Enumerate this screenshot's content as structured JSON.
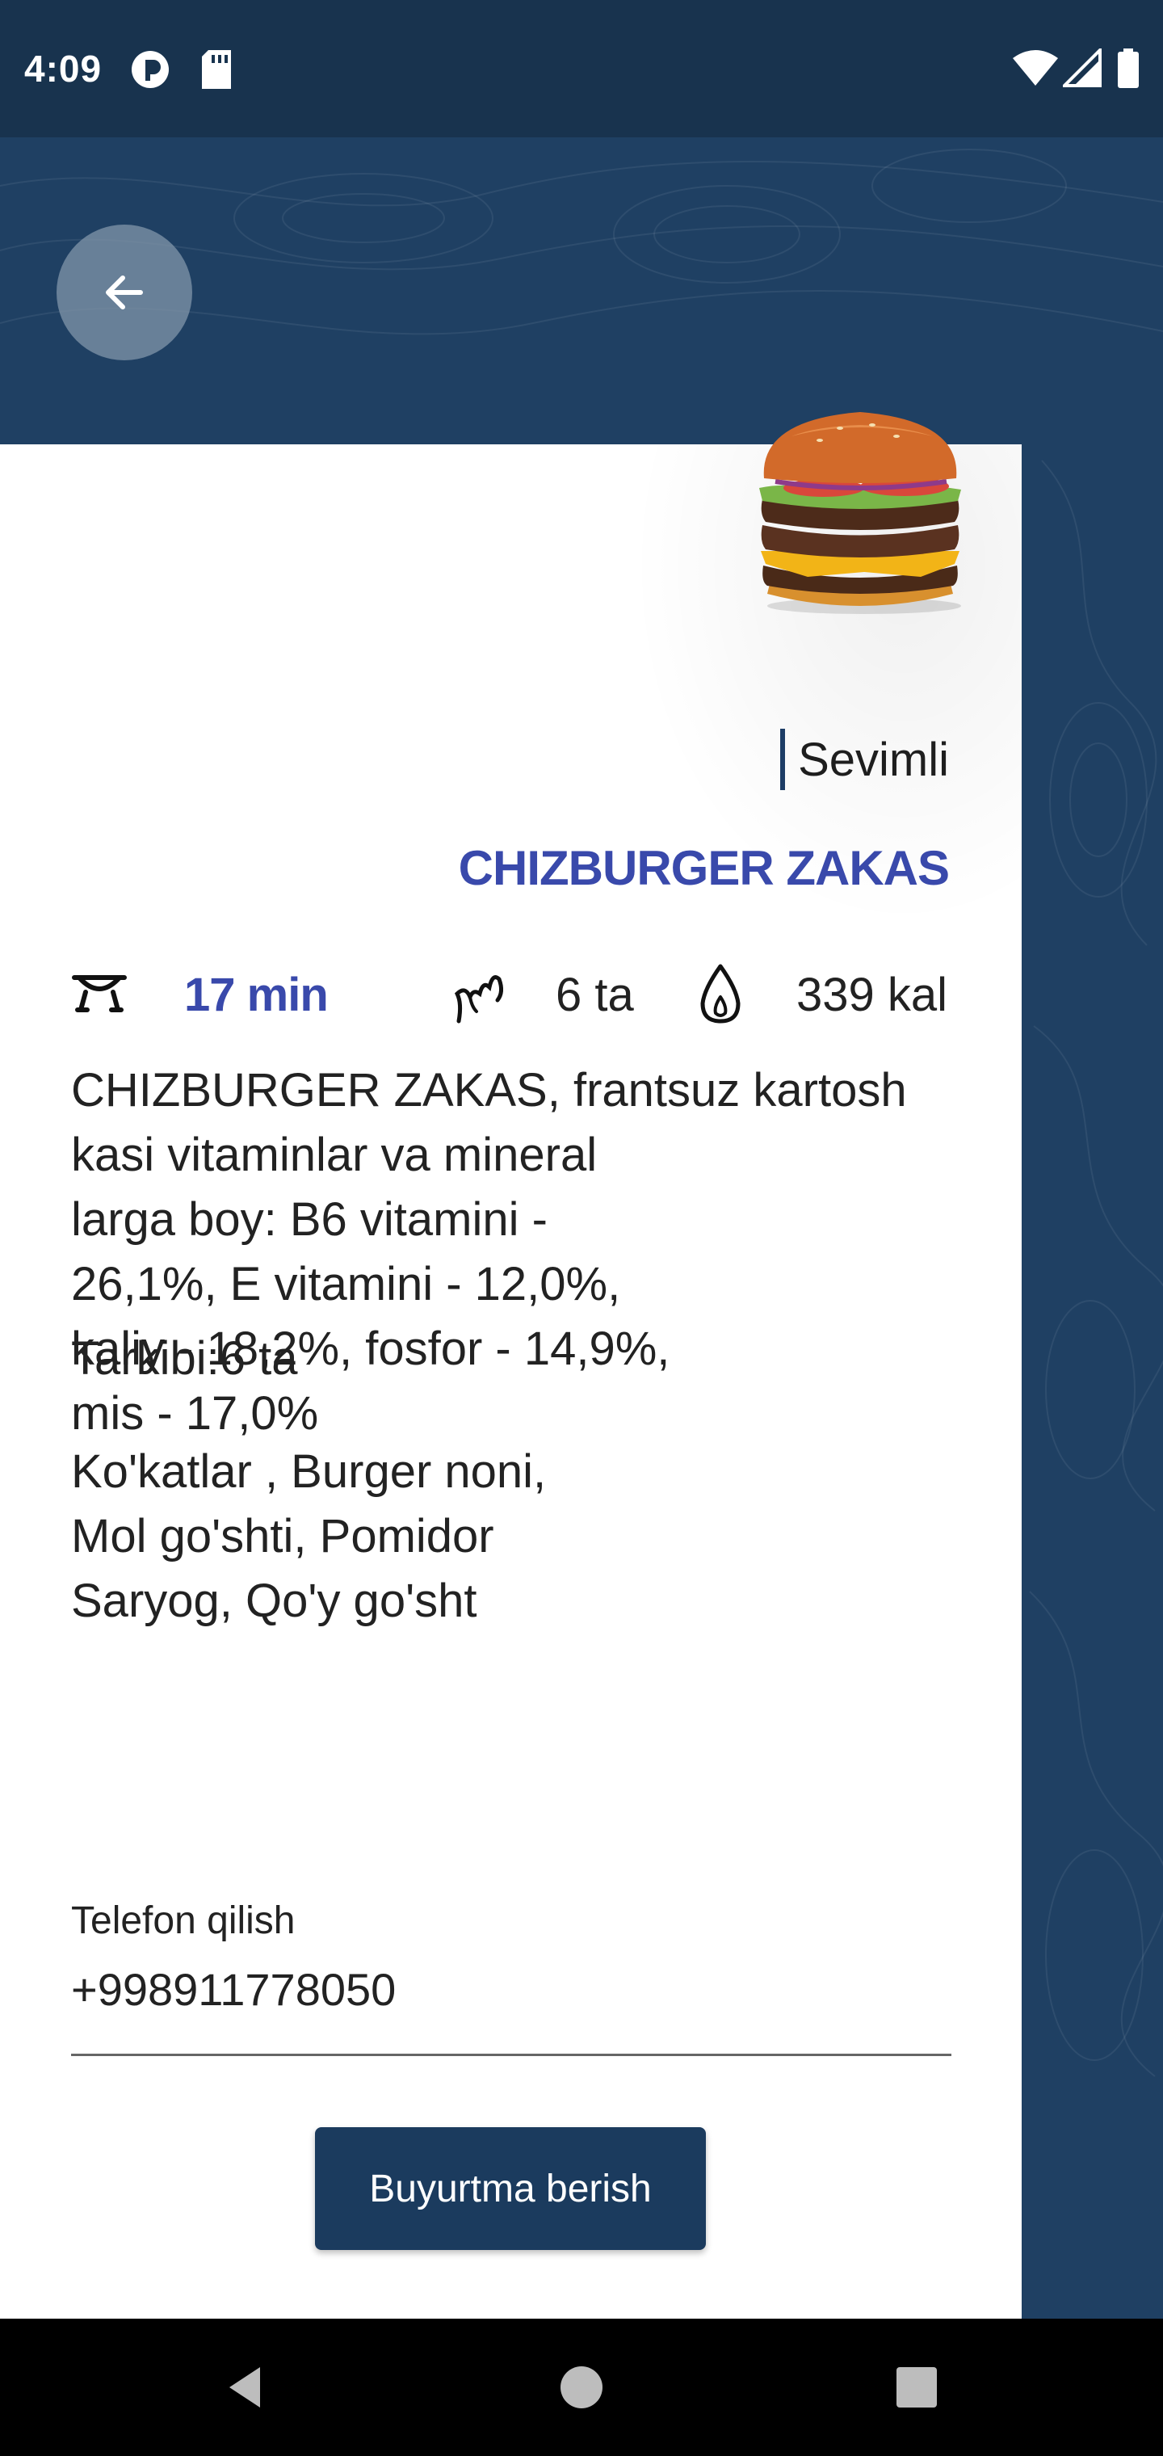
{
  "status_bar": {
    "time": "4:09"
  },
  "product": {
    "favorite_label": "Sevimli",
    "title": "CHIZBURGER ZAKAS",
    "stats": {
      "time": "17 min",
      "ingredients_count": "6 ta",
      "calories": "339 kal"
    },
    "description": "CHIZBURGER ZAKAS, frantsuz kartosh\nkasi vitaminlar va mineral\nlarga boy: B6 vitamini -\n26,1%, E vitamini - 12,0%,\nkaliy - 18,2%, fosfor - 14,9%,\nmis - 17,0%",
    "composition_label": "Tarkibi:6 ta",
    "ingredients": "Ko'katlar , Burger noni,\nMol go'shti, Pomidor\nSaryog, Qo'y go'sht"
  },
  "phone": {
    "label": "Telefon qilish",
    "value": "+998911778050"
  },
  "order_button_label": "Buyurtma berish",
  "icons": {
    "back": "arrow-left-icon",
    "bowl": "bowl-icon",
    "ingredients": "herb-icon",
    "calories": "flame-icon"
  },
  "colors": {
    "background": "#1f4063",
    "accent": "#3949ab",
    "button": "#1b3b5e"
  }
}
